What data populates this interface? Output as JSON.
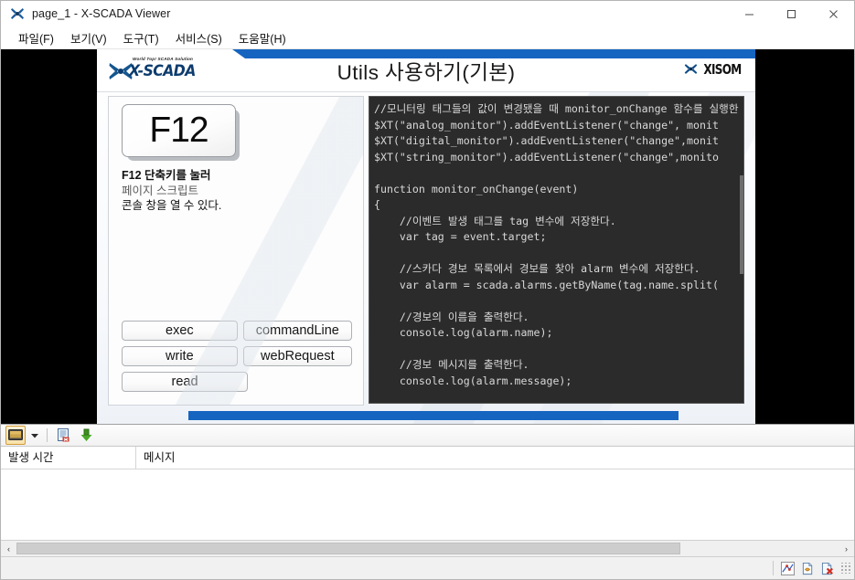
{
  "window": {
    "title": "page_1 - X-SCADA Viewer",
    "app_icon": "xscada-star-icon",
    "minimize_label": "─",
    "maximize_label": "□",
    "close_label": "✕"
  },
  "menubar": {
    "items": [
      {
        "label": "파일(F)",
        "name": "menu-file"
      },
      {
        "label": "보기(V)",
        "name": "menu-view"
      },
      {
        "label": "도구(T)",
        "name": "menu-tools"
      },
      {
        "label": "서비스(S)",
        "name": "menu-service"
      },
      {
        "label": "도움말(H)",
        "name": "menu-help"
      }
    ]
  },
  "slide": {
    "logo": {
      "tagline": "World Top! SCADA Solution",
      "wordmark": "X-SCADA",
      "brand_right": "XISOM"
    },
    "title": "Utils 사용하기(기본)",
    "accent_color": "#1565c0",
    "left": {
      "key_label": "F12",
      "desc_line1": "F12 단축키를 눌러",
      "desc_line2": "페이지 스크립트",
      "desc_line3": "콘솔 창을 열 수 있다.",
      "buttons": [
        {
          "label": "exec",
          "name": "exec-button"
        },
        {
          "label": "commandLine",
          "name": "command-line-button"
        },
        {
          "label": "write",
          "name": "write-button"
        },
        {
          "label": "webRequest",
          "name": "web-request-button"
        },
        {
          "label": "read",
          "name": "read-button"
        }
      ]
    },
    "code": {
      "background": "#2b2b2b",
      "text": "//모니터링 태그들의 값이 변경됐을 때 monitor_onChange 함수를 실행한\n$XT(\"analog_monitor\").addEventListener(\"change\", monit\n$XT(\"digital_monitor\").addEventListener(\"change\",monit\n$XT(\"string_monitor\").addEventListener(\"change\",monito\n\nfunction monitor_onChange(event)\n{\n    //이벤트 발생 태그를 tag 변수에 저장한다.\n    var tag = event.target;\n\n    //스카다 경보 목록에서 경보를 찾아 alarm 변수에 저장한다.\n    var alarm = scada.alarms.getByName(tag.name.split(\n\n    //경보의 이름을 출력한다.\n    console.log(alarm.name);\n\n    //경보 메시지를 출력한다.\n    console.log(alarm.message);"
    }
  },
  "log": {
    "toolbar": {
      "display_mode_icon": "monitor-icon",
      "dropdown_icon": "chevron-down-icon",
      "clear_log_icon": "clear-log-icon",
      "save_log_icon": "download-log-icon"
    },
    "columns": [
      {
        "label": "발생 시간",
        "name": "column-occurrence-time"
      },
      {
        "label": "메시지",
        "name": "column-message"
      }
    ],
    "rows": [],
    "scroll": {
      "left_arrow": "‹",
      "right_arrow": "›"
    }
  },
  "statusbar": {
    "icons": [
      {
        "name": "chart-tool-icon"
      },
      {
        "name": "copy-page-icon"
      },
      {
        "name": "delete-page-icon"
      }
    ]
  }
}
